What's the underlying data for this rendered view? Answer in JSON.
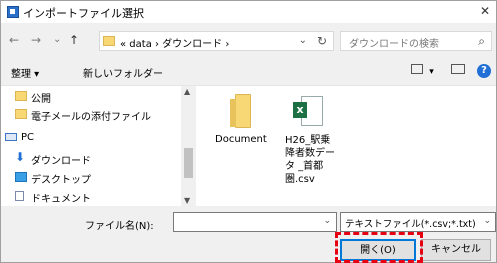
{
  "window": {
    "title": "インポートファイル選択",
    "close_glyph": "✕"
  },
  "nav": {
    "back": "←",
    "forward": "→",
    "dropdown": "⌄",
    "up": "↑"
  },
  "address": {
    "crumbs": "« data › ダウンロード ›",
    "chevron": "⌄",
    "refresh": "↻",
    "search_placeholder": "ダウンロードの検索",
    "search_icon": "⌕"
  },
  "toolbar": {
    "organize": "整理 ▾",
    "new_folder": "新しいフォルダー",
    "view_menu": "▾",
    "help": "?"
  },
  "sidebar": {
    "items": [
      {
        "label": "公開",
        "icon": "folder-icon"
      },
      {
        "label": "電子メールの添付ファイル",
        "icon": "folder-icon"
      },
      {
        "label": "PC",
        "icon": "pc-icon"
      },
      {
        "label": "ダウンロード",
        "icon": "download-icon"
      },
      {
        "label": "デスクトップ",
        "icon": "desktop-icon"
      },
      {
        "label": "ドキュメント",
        "icon": "document-icon"
      }
    ],
    "scroll_up": "▲",
    "scroll_down": "▼"
  },
  "files": [
    {
      "name": "Document",
      "type": "folder"
    },
    {
      "name_lines": [
        "H26_駅乗",
        "降者数デー",
        "タ _首都",
        "圏.csv"
      ],
      "type": "excel-csv"
    }
  ],
  "bottom": {
    "filename_label": "ファイル名(N):",
    "filename_value": "",
    "filename_chevron": "⌄",
    "filetype": "テキストファイル(*.csv;*.txt)",
    "filetype_chevron": "⌄",
    "open_label": "開く(O)",
    "cancel_label": "キャンセル"
  },
  "colors": {
    "highlight": "#e60012",
    "accent": "#0078d7"
  }
}
